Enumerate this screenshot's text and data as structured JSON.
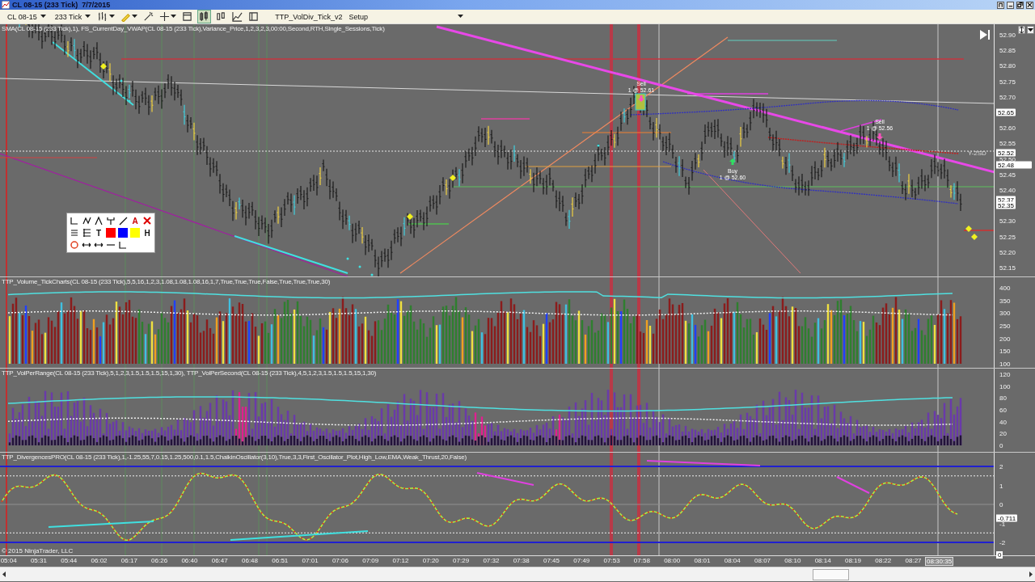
{
  "window": {
    "title": "CL 08-15 (233 Tick)  7/7/2015"
  },
  "toolbar": {
    "instrument": "CL 08-15",
    "interval": "233 Tick",
    "template": "TTP_VolDiv_Tick_v2",
    "template_dropdown": "Setup"
  },
  "panels": [
    {
      "kind": "price",
      "label": "SMA(CL 08-15 (233 Tick),1), FS_CurrentDay_VWAP(CL 08-15 (233 Tick),Variance_Price,1,2,3,2,3,00:00,Second,RTH,Single_Sessions,Tick)",
      "axis_ticks": [
        "52.90",
        "52.85",
        "52.80",
        "52.75",
        "52.70",
        "52.60",
        "52.55",
        "52.50",
        "52.45",
        "52.40",
        "52.30",
        "52.25",
        "52.20",
        "52.15"
      ],
      "markers": [
        {
          "text": "52.65",
          "kind": "price"
        },
        {
          "text": "52.52",
          "kind": "price"
        },
        {
          "text": "52.48",
          "kind": "last"
        },
        {
          "text": "52.37",
          "kind": "price"
        },
        {
          "text": "52.35",
          "kind": "price"
        }
      ],
      "band_label": "Y-2SD",
      "orders": [
        {
          "kind": "sell",
          "label": "Sell",
          "fill": "1 @ 52.61"
        },
        {
          "kind": "sell",
          "label": "Sell",
          "fill": "1 @ 52.56"
        },
        {
          "kind": "buy",
          "label": "Buy",
          "fill": "1 @ 52.60"
        }
      ],
      "drawing_tools": [
        {
          "kind": "corner"
        },
        {
          "kind": "zigzag"
        },
        {
          "kind": "peak"
        },
        {
          "kind": "pitchfork"
        },
        {
          "kind": "line"
        },
        {
          "kind": "text",
          "glyph": "A"
        },
        {
          "kind": "delete"
        },
        {
          "kind": "lines"
        },
        {
          "kind": "fib"
        },
        {
          "kind": "text",
          "glyph": "T"
        },
        {
          "kind": "swatch",
          "color": "#ff0000"
        },
        {
          "kind": "swatch",
          "color": "#0000ff"
        },
        {
          "kind": "swatch",
          "color": "#ffff00"
        },
        {
          "kind": "text",
          "glyph": "H"
        },
        {
          "kind": "circle"
        },
        {
          "kind": "arrows"
        },
        {
          "kind": "arrows"
        },
        {
          "kind": "hline"
        },
        {
          "kind": "corner"
        }
      ]
    },
    {
      "kind": "volume",
      "label": "TTP_Volume_TickCharts(CL 08-15 (233 Tick),5,5,16,1,2,3,1.08,1.08,1.08,16,1,7,True,True,True,False,True,True,True,30)",
      "axis_ticks": [
        "400",
        "350",
        "300",
        "250",
        "200",
        "150",
        "100"
      ]
    },
    {
      "kind": "volper",
      "label": "TTP_VolPerRange(CL 08-15 (233 Tick),5,1,2,3,1.5,1.5,1.5,15,1,30), TTP_VolPerSecond(CL 08-15 (233 Tick),4,5,1,2,3,1.5,1.5,1.5,15,1,30)",
      "axis_ticks": [
        "120",
        "100",
        "80",
        "60",
        "40",
        "20",
        "0"
      ]
    },
    {
      "kind": "divergence",
      "label": "TTP_DivergencesPRO(CL 08-15 (233 Tick),1,-1.25,55,7,0.15,1.25,500,0.1,1.5,ChaikinOscillator(3,10),True,3,3,First_Oscillator_Plot,High_Low,EMA,Weak_Thrust,20,False)",
      "axis_ticks": [
        "2",
        "1",
        "0",
        "-1",
        "-2"
      ],
      "markers": [
        {
          "text": "-0.711",
          "kind": "price"
        }
      ],
      "copyright": "© 2015 NinjaTrader, LLC"
    }
  ],
  "time_axis": {
    "ticks": [
      "05:04",
      "05:31",
      "05:44",
      "06:02",
      "06:17",
      "06:26",
      "06:40",
      "06:47",
      "06:48",
      "06:51",
      "07:01",
      "07:06",
      "07:09",
      "07:12",
      "07:20",
      "07:29",
      "07:32",
      "07:38",
      "07:45",
      "07:49",
      "07:53",
      "07:58",
      "08:00",
      "08:01",
      "08:04",
      "08:07",
      "08:10",
      "08:14",
      "08:19",
      "08:22",
      "08:27"
    ],
    "cursor_time": "08:30:35",
    "end_marker": "0"
  }
}
